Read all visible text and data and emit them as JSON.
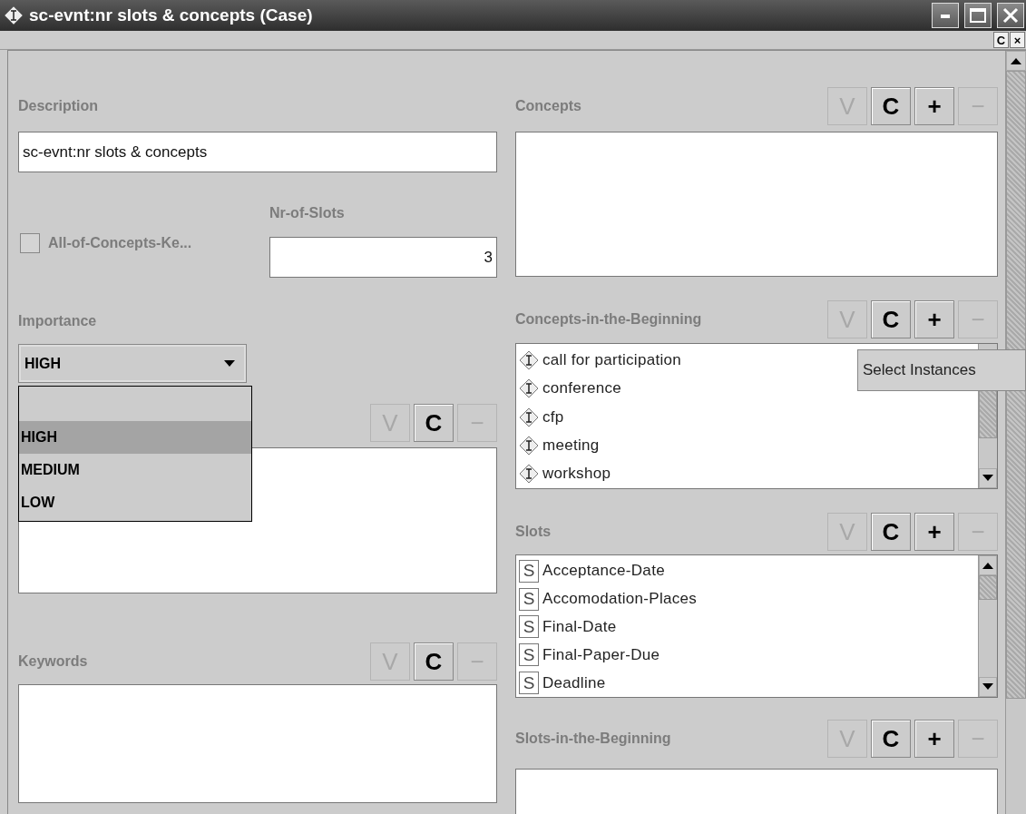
{
  "window": {
    "title": "sc-evnt:nr slots & concepts (Case)"
  },
  "toolbar": {
    "buttons": [
      "C",
      "×"
    ]
  },
  "description": {
    "label": "Description",
    "value": "sc-evnt:nr slots & concepts"
  },
  "all_of_concepts": {
    "label": "All-of-Concepts-Ke...",
    "checked": false
  },
  "nr_of_slots": {
    "label": "Nr-of-Slots",
    "value": "3"
  },
  "importance": {
    "label": "Importance",
    "value": "HIGH",
    "expanded": true,
    "options": [
      {
        "label": "HIGH",
        "selected": true
      },
      {
        "label": "MEDIUM",
        "selected": false
      },
      {
        "label": "LOW",
        "selected": false
      }
    ]
  },
  "list_4": {
    "buttons": [
      {
        "label": "V",
        "disabled": true
      },
      {
        "label": "C",
        "disabled": false
      },
      {
        "label": "−",
        "disabled": true
      }
    ]
  },
  "keywords": {
    "label": "Keywords",
    "buttons": [
      {
        "label": "V",
        "disabled": true
      },
      {
        "label": "C",
        "disabled": false
      },
      {
        "label": "−",
        "disabled": true
      }
    ]
  },
  "concepts": {
    "label": "Concepts",
    "buttons": [
      {
        "label": "V",
        "disabled": true
      },
      {
        "label": "C",
        "disabled": false
      },
      {
        "label": "+",
        "disabled": false
      },
      {
        "label": "−",
        "disabled": true
      }
    ]
  },
  "concepts_in_the_beginning": {
    "label": "Concepts-in-the-Beginning",
    "buttons": [
      {
        "label": "V",
        "disabled": true
      },
      {
        "label": "C",
        "disabled": false
      },
      {
        "label": "+",
        "disabled": false
      },
      {
        "label": "−",
        "disabled": true
      }
    ],
    "items": [
      {
        "kind": "instance",
        "label": "call for participation"
      },
      {
        "kind": "instance",
        "label": "conference"
      },
      {
        "kind": "instance",
        "label": "cfp"
      },
      {
        "kind": "instance",
        "label": "meeting"
      },
      {
        "kind": "instance",
        "label": "workshop"
      }
    ]
  },
  "tooltip": "Select Instances",
  "slots": {
    "label": "Slots",
    "buttons": [
      {
        "label": "V",
        "disabled": true
      },
      {
        "label": "C",
        "disabled": false
      },
      {
        "label": "+",
        "disabled": false
      },
      {
        "label": "−",
        "disabled": true
      }
    ],
    "items": [
      {
        "kind": "slot",
        "badge": "S",
        "label": "Acceptance-Date"
      },
      {
        "kind": "slot",
        "badge": "S",
        "label": "Accomodation-Places"
      },
      {
        "kind": "slot",
        "badge": "S",
        "label": "Final-Date"
      },
      {
        "kind": "slot",
        "badge": "S",
        "label": "Final-Paper-Due"
      },
      {
        "kind": "slot",
        "badge": "S",
        "label": "Deadline"
      }
    ]
  },
  "slots_in_the_beginning": {
    "label": "Slots-in-the-Beginning",
    "buttons": [
      {
        "label": "V",
        "disabled": true
      },
      {
        "label": "C",
        "disabled": false
      },
      {
        "label": "+",
        "disabled": false
      },
      {
        "label": "−",
        "disabled": true
      }
    ]
  }
}
